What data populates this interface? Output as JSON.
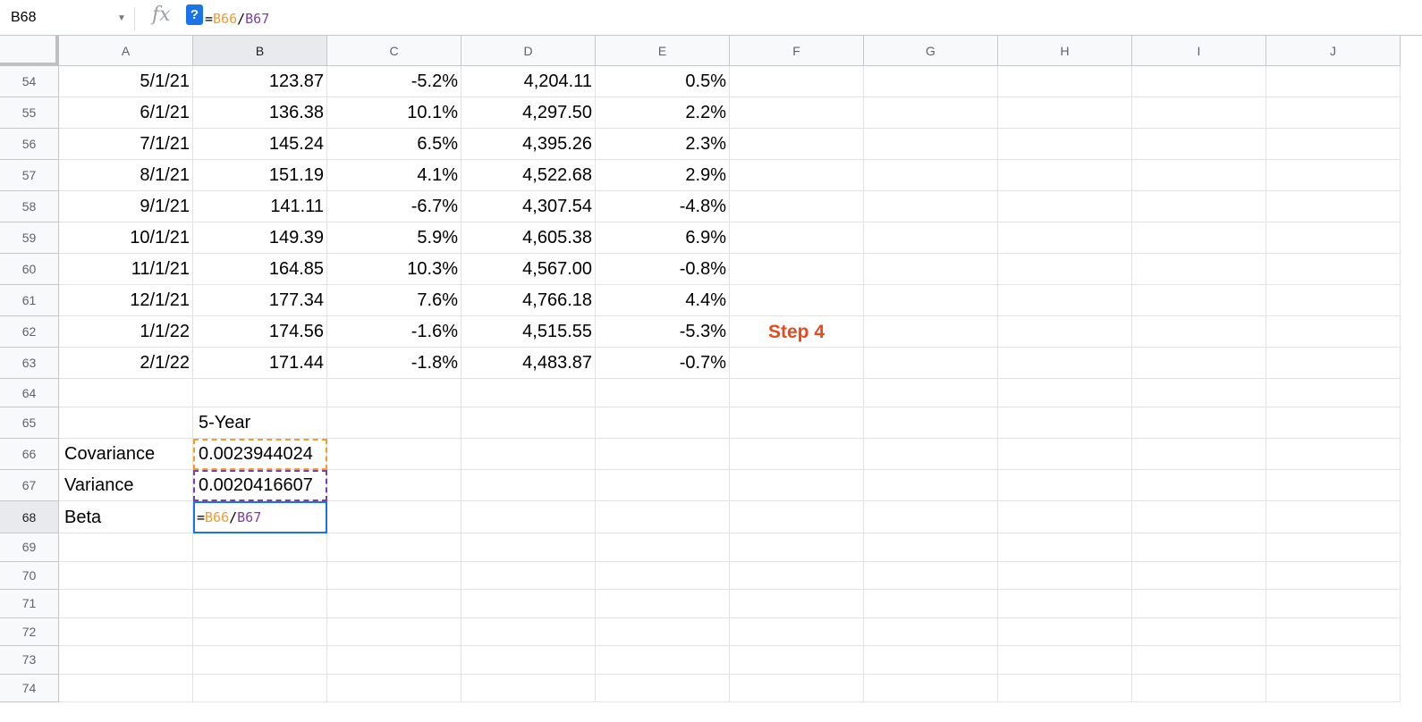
{
  "formula_bar": {
    "cell_ref": "B68",
    "help_label": "?",
    "fx_label": "fx",
    "formula_eq": "=",
    "formula_ref1": "B66",
    "formula_sep": "/",
    "formula_ref2": "B67"
  },
  "columns": [
    "A",
    "B",
    "C",
    "D",
    "E",
    "F",
    "G",
    "H",
    "I",
    "J"
  ],
  "data_rows": [
    {
      "row": "54",
      "a": "5/1/21",
      "b": "123.87",
      "c": "-5.2%",
      "d": "4,204.11",
      "e": "0.5%"
    },
    {
      "row": "55",
      "a": "6/1/21",
      "b": "136.38",
      "c": "10.1%",
      "d": "4,297.50",
      "e": "2.2%"
    },
    {
      "row": "56",
      "a": "7/1/21",
      "b": "145.24",
      "c": "6.5%",
      "d": "4,395.26",
      "e": "2.3%"
    },
    {
      "row": "57",
      "a": "8/1/21",
      "b": "151.19",
      "c": "4.1%",
      "d": "4,522.68",
      "e": "2.9%"
    },
    {
      "row": "58",
      "a": "9/1/21",
      "b": "141.11",
      "c": "-6.7%",
      "d": "4,307.54",
      "e": "-4.8%"
    },
    {
      "row": "59",
      "a": "10/1/21",
      "b": "149.39",
      "c": "5.9%",
      "d": "4,605.38",
      "e": "6.9%"
    },
    {
      "row": "60",
      "a": "11/1/21",
      "b": "164.85",
      "c": "10.3%",
      "d": "4,567.00",
      "e": "-0.8%"
    },
    {
      "row": "61",
      "a": "12/1/21",
      "b": "177.34",
      "c": "7.6%",
      "d": "4,766.18",
      "e": "4.4%"
    },
    {
      "row": "62",
      "a": "1/1/22",
      "b": "174.56",
      "c": "-1.6%",
      "d": "4,515.55",
      "e": "-5.3%"
    },
    {
      "row": "63",
      "a": "2/1/22",
      "b": "171.44",
      "c": "-1.8%",
      "d": "4,483.87",
      "e": "-0.7%"
    }
  ],
  "step_label": "Step 4",
  "summary": {
    "r64": "64",
    "r65": "65",
    "header_b": "5-Year",
    "r66": "66",
    "cov_label": "Covariance",
    "cov_value": "0.0023944024",
    "r67": "67",
    "var_label": "Variance",
    "var_value": "0.0020416607",
    "r68": "68",
    "beta_label": "Beta",
    "beta_eq": "=",
    "beta_ref1": "B66",
    "beta_sep": "/",
    "beta_ref2": "B67"
  },
  "empty_rows": [
    "69",
    "70",
    "71",
    "72",
    "73",
    "74"
  ]
}
